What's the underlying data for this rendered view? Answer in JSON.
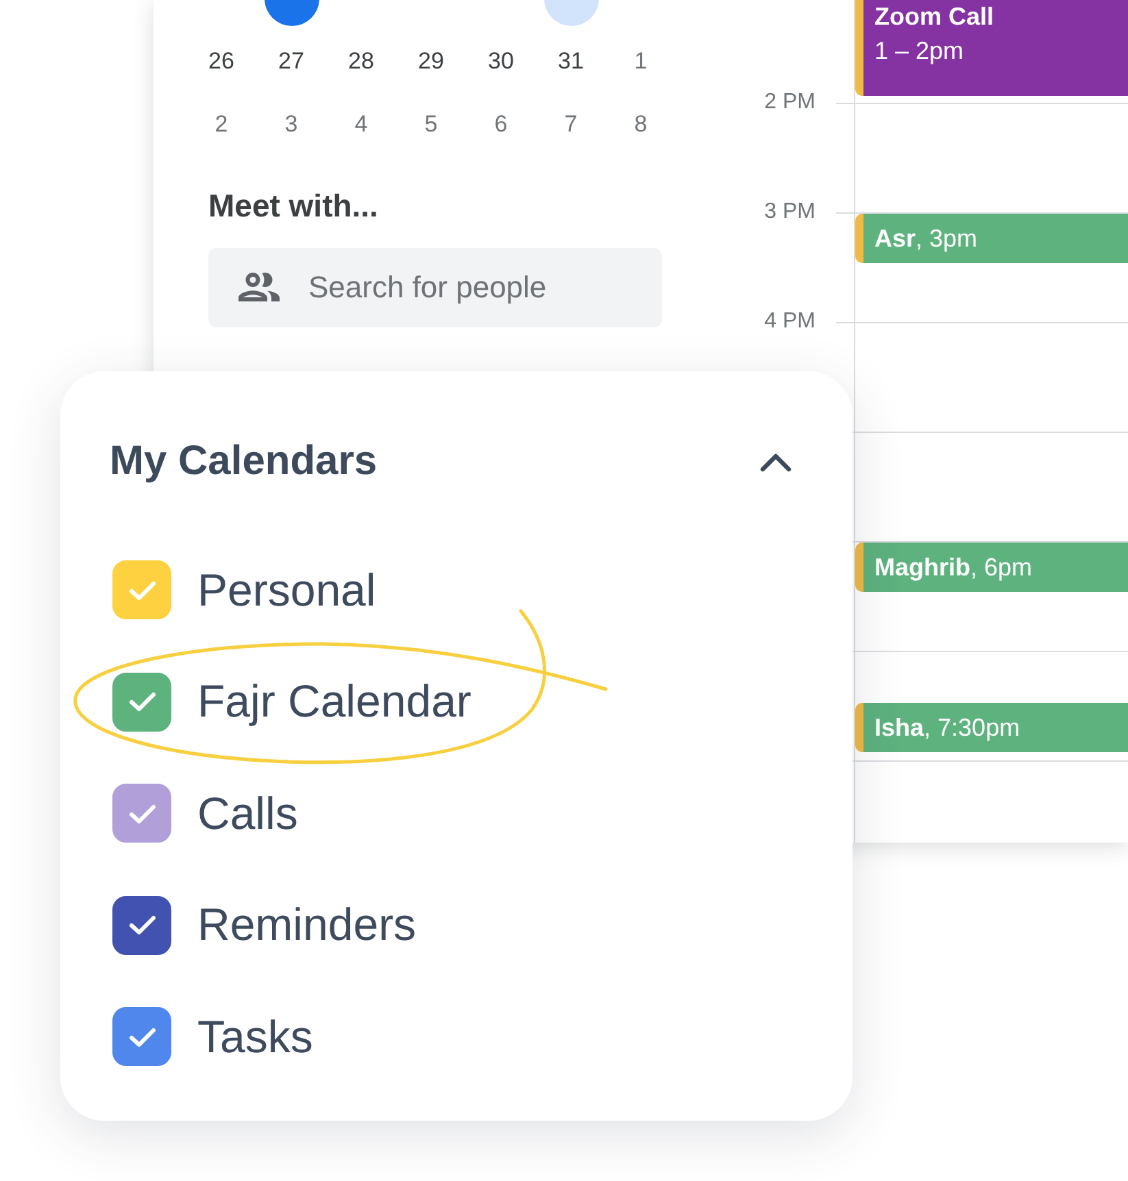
{
  "mini_calendar": {
    "partial_week": [
      {
        "today": false,
        "selected": false
      },
      {
        "today": true,
        "selected": false
      },
      {
        "today": false,
        "selected": false
      },
      {
        "today": false,
        "selected": false
      },
      {
        "today": false,
        "selected": false
      },
      {
        "today": false,
        "selected": true
      },
      {
        "today": false,
        "selected": false
      }
    ],
    "weeks": [
      [
        {
          "day": "26",
          "other_month": false
        },
        {
          "day": "27",
          "other_month": false
        },
        {
          "day": "28",
          "other_month": false
        },
        {
          "day": "29",
          "other_month": false
        },
        {
          "day": "30",
          "other_month": false
        },
        {
          "day": "31",
          "other_month": false
        },
        {
          "day": "1",
          "other_month": true
        }
      ],
      [
        {
          "day": "2",
          "other_month": true
        },
        {
          "day": "3",
          "other_month": true
        },
        {
          "day": "4",
          "other_month": true
        },
        {
          "day": "5",
          "other_month": true
        },
        {
          "day": "6",
          "other_month": true
        },
        {
          "day": "7",
          "other_month": true
        },
        {
          "day": "8",
          "other_month": true
        }
      ]
    ]
  },
  "meet_with": {
    "title": "Meet with...",
    "search": {
      "placeholder": "Search for people"
    }
  },
  "schedule": {
    "hours": [
      {
        "events": [
          {
            "kind": "full",
            "title": "Zoom Call",
            "time": "1 – 2pm",
            "color": "#8532a2"
          }
        ]
      },
      {
        "label": "2 PM",
        "divider": true
      },
      {
        "label": "3 PM",
        "divider": true,
        "events": [
          {
            "kind": "top",
            "text": "**Asr**, 3pm",
            "color": "#5db27e"
          }
        ]
      },
      {
        "label": "4 PM",
        "divider": true
      },
      {
        "divider": true
      },
      {
        "divider": true,
        "events": [
          {
            "kind": "top",
            "text": "**Maghrib**, 6pm",
            "color": "#5db27e"
          }
        ]
      },
      {
        "divider": true,
        "events": [
          {
            "kind": "half",
            "text": "**Isha**, 7:30pm",
            "color": "#5db27e"
          }
        ]
      },
      {
        "divider": true
      }
    ]
  },
  "my_calendars": {
    "title": "My Calendars",
    "expanded": true,
    "items": [
      {
        "label": "Personal",
        "checked": true,
        "color": "#fdd13f"
      },
      {
        "label": "Fajr Calendar",
        "checked": true,
        "color": "#5db27e"
      },
      {
        "label": "Calls",
        "checked": true,
        "color": "#b09fd9"
      },
      {
        "label": "Reminders",
        "checked": true,
        "color": "#4152b0"
      },
      {
        "label": "Tasks",
        "checked": true,
        "color": "#4f87ec"
      }
    ]
  }
}
